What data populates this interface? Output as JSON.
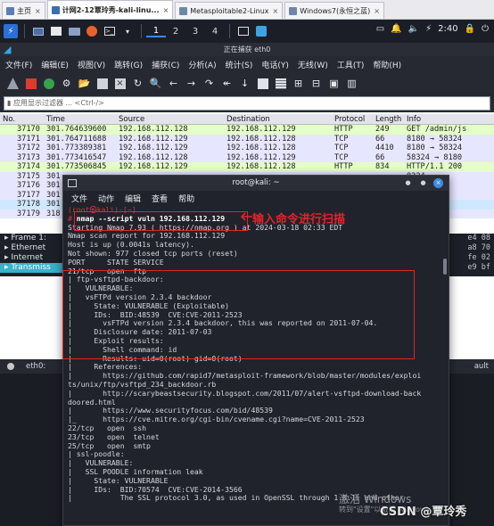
{
  "vm_tabs": [
    {
      "label": "主页",
      "active": false
    },
    {
      "label": "计网2-12覃玲秀-kali-linu...",
      "active": true
    },
    {
      "label": "Metasploitable2-Linux",
      "active": false
    },
    {
      "label": "Windows7(永恒之蓝)",
      "active": false
    }
  ],
  "panel": {
    "workspaces": [
      "1",
      "2",
      "3",
      "4"
    ],
    "clock": "2:40"
  },
  "wireshark": {
    "title": "正在捕获 eth0",
    "menu": [
      "文件(F)",
      "编辑(E)",
      "视图(V)",
      "跳转(G)",
      "捕获(C)",
      "分析(A)",
      "统计(S)",
      "电话(Y)",
      "无线(W)",
      "工具(T)",
      "帮助(H)"
    ],
    "filter_placeholder": "应用显示过滤器 ... <Ctrl-/>",
    "columns": [
      "No.",
      "Time",
      "Source",
      "Destination",
      "Protocol",
      "Length",
      "Info"
    ],
    "packets": [
      {
        "no": "37170",
        "time": "301.764639600",
        "src": "192.168.112.128",
        "dst": "192.168.112.129",
        "proto": "HTTP",
        "len": "249",
        "info": "GET /admin/js",
        "cls": "http"
      },
      {
        "no": "37171",
        "time": "301.764711688",
        "src": "192.168.112.129",
        "dst": "192.168.112.128",
        "proto": "TCP",
        "len": "66",
        "info": "8180 → 58324",
        "cls": "tcp"
      },
      {
        "no": "37172",
        "time": "301.773389381",
        "src": "192.168.112.129",
        "dst": "192.168.112.128",
        "proto": "TCP",
        "len": "4410",
        "info": "8180 → 58324",
        "cls": "tcp"
      },
      {
        "no": "37173",
        "time": "301.773416547",
        "src": "192.168.112.128",
        "dst": "192.168.112.129",
        "proto": "TCP",
        "len": "66",
        "info": "58324 → 8180",
        "cls": "tcp"
      },
      {
        "no": "37174",
        "time": "301.773506845",
        "src": "192.168.112.129",
        "dst": "192.168.112.128",
        "proto": "HTTP",
        "len": "834",
        "info": "HTTP/1.1 200",
        "cls": "http"
      },
      {
        "no": "37175",
        "time": "301",
        "src": "",
        "dst": "",
        "proto": "",
        "len": "",
        "info": "8324",
        "cls": "tcp"
      },
      {
        "no": "37176",
        "time": "301",
        "src": "",
        "dst": "",
        "proto": "",
        "len": "",
        "info": "8180",
        "cls": "tcp"
      },
      {
        "no": "37177",
        "time": "301",
        "src": "",
        "dst": "",
        "proto": "",
        "len": "",
        "info": "8324",
        "cls": "tcp"
      },
      {
        "no": "37178",
        "time": "301",
        "src": "",
        "dst": "",
        "proto": "",
        "len": "",
        "info": "8180",
        "cls": "sel"
      },
      {
        "no": "37179",
        "time": "318",
        "src": "",
        "dst": "",
        "proto": "",
        "len": "",
        "info": "XID:",
        "cls": "tcp"
      }
    ],
    "details": [
      {
        "label": "Frame 1:",
        "hex": "e4 08"
      },
      {
        "label": "Ethernet",
        "hex": "a8 70"
      },
      {
        "label": "Internet",
        "hex": "fe 02"
      },
      {
        "label": "Transmiss",
        "hex": "e9 bf"
      }
    ],
    "status": {
      "iface": "eth0:",
      "profile": "ault"
    }
  },
  "terminal": {
    "title": "root@kali: ~",
    "menu": [
      "文件",
      "动作",
      "编辑",
      "查看",
      "帮助"
    ],
    "prompt_user": "(root㉿kali)-[~]",
    "prompt_hash": "# ",
    "command": "nmap --script vuln 192.168.112.129",
    "lines": [
      "Starting Nmap 7.93 ( https://nmap.org ) at 2024-03-18 02:33 EDT",
      "Nmap scan report for 192.168.112.129",
      "Host is up (0.0041s latency).",
      "Not shown: 977 closed tcp ports (reset)",
      "PORT     STATE SERVICE",
      "21/tcp   open  ftp",
      "| ftp-vsftpd-backdoor:",
      "|   VULNERABLE:",
      "|   vsFTPd version 2.3.4 backdoor",
      "|     State: VULNERABLE (Exploitable)",
      "|     IDs:  BID:48539  CVE:CVE-2011-2523",
      "|       vsFTPd version 2.3.4 backdoor, this was reported on 2011-07-04.",
      "|     Disclosure date: 2011-07-03",
      "|     Exploit results:",
      "|       Shell command: id",
      "|       Results: uid=0(root) gid=0(root)",
      "|     References:",
      "|       https://github.com/rapid7/metasploit-framework/blob/master/modules/exploi",
      "ts/unix/ftp/vsftpd_234_backdoor.rb",
      "|       http://scarybeastsecurity.blogspot.com/2011/07/alert-vsftpd-download-back",
      "doored.html",
      "|       https://www.securityfocus.com/bid/48539",
      "|_      https://cve.mitre.org/cgi-bin/cvename.cgi?name=CVE-2011-2523",
      "22/tcp   open  ssh",
      "23/tcp   open  telnet",
      "25/tcp   open  smtp",
      "| ssl-poodle:",
      "|   VULNERABLE:",
      "|   SSL POODLE information leak",
      "|     State: VULNERABLE",
      "|     IDs:  BID:70574  CVE:CVE-2014-3566",
      "|           The SSL protocol 3.0, as used in OpenSSL through 1.0.1i and other"
    ]
  },
  "annotation": {
    "label": "输入命令进行扫描",
    "color": "#e0242b"
  },
  "watermarks": {
    "activate": "激活 Windows",
    "activate_sub": "转到\"设置\"以激活 Windows。",
    "csdn": "CSDN @覃玲秀"
  }
}
